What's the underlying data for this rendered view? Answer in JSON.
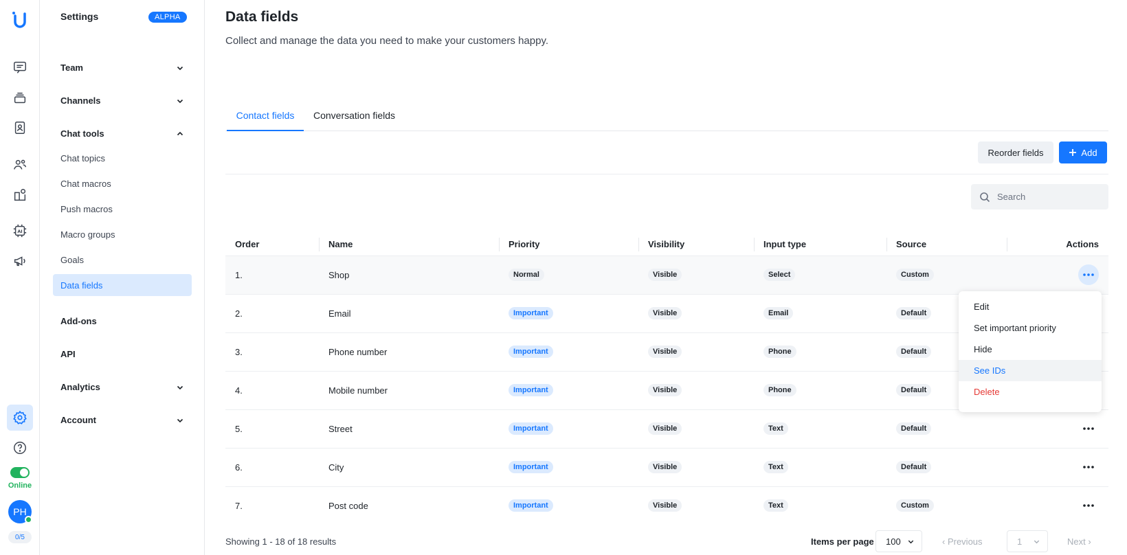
{
  "rail": {
    "logo": "U",
    "icons": [
      "chat-icon",
      "inbox-stack-icon",
      "contacts-icon",
      "users-icon",
      "widget-icon",
      "ai-chip-icon",
      "megaphone-icon",
      "settings-gear-icon",
      "help-icon"
    ],
    "status_label": "Online",
    "avatar_initials": "PH",
    "counter": "0/5"
  },
  "sidebar": {
    "title": "Settings",
    "badge": "ALPHA",
    "groups": {
      "team": "Team",
      "channels": "Channels",
      "chat_tools": "Chat tools",
      "addons": "Add-ons",
      "api": "API",
      "analytics": "Analytics",
      "account": "Account"
    },
    "chat_tools_items": [
      "Chat topics",
      "Chat macros",
      "Push macros",
      "Macro groups",
      "Goals",
      "Data fields"
    ]
  },
  "header": {
    "title": "Data fields",
    "subtitle": "Collect and manage the data you need to make your customers happy."
  },
  "tabs": [
    "Contact fields",
    "Conversation fields"
  ],
  "toolbar": {
    "reorder_label": "Reorder fields",
    "add_label": "Add",
    "search_placeholder": "Search"
  },
  "table": {
    "columns": [
      "Order",
      "Name",
      "Priority",
      "Visibility",
      "Input type",
      "Source",
      "Actions"
    ],
    "rows": [
      {
        "order": "1.",
        "name": "Shop",
        "priority": "Normal",
        "visibility": "Visible",
        "input_type": "Select",
        "source": "Custom"
      },
      {
        "order": "2.",
        "name": "Email",
        "priority": "Important",
        "visibility": "Visible",
        "input_type": "Email",
        "source": "Default"
      },
      {
        "order": "3.",
        "name": "Phone number",
        "priority": "Important",
        "visibility": "Visible",
        "input_type": "Phone",
        "source": "Default"
      },
      {
        "order": "4.",
        "name": "Mobile number",
        "priority": "Important",
        "visibility": "Visible",
        "input_type": "Phone",
        "source": "Default"
      },
      {
        "order": "5.",
        "name": "Street",
        "priority": "Important",
        "visibility": "Visible",
        "input_type": "Text",
        "source": "Default"
      },
      {
        "order": "6.",
        "name": "City",
        "priority": "Important",
        "visibility": "Visible",
        "input_type": "Text",
        "source": "Default"
      },
      {
        "order": "7.",
        "name": "Post code",
        "priority": "Important",
        "visibility": "Visible",
        "input_type": "Text",
        "source": "Custom"
      }
    ]
  },
  "context_menu": {
    "items": [
      "Edit",
      "Set important priority",
      "Hide",
      "See IDs",
      "Delete"
    ],
    "hovered": "See IDs",
    "danger": "Delete"
  },
  "footer": {
    "showing": "Showing 1 - 18 of 18 results",
    "items_per_page_label": "Items per page",
    "items_per_page_value": "100",
    "previous_label": "Previous",
    "page_value": "1",
    "next_label": "Next"
  },
  "colors": {
    "accent": "#1677ff",
    "online": "#22b35e",
    "danger": "#e53935",
    "tag_bg": "#eef1f5",
    "active_bg": "#dbeafe"
  }
}
